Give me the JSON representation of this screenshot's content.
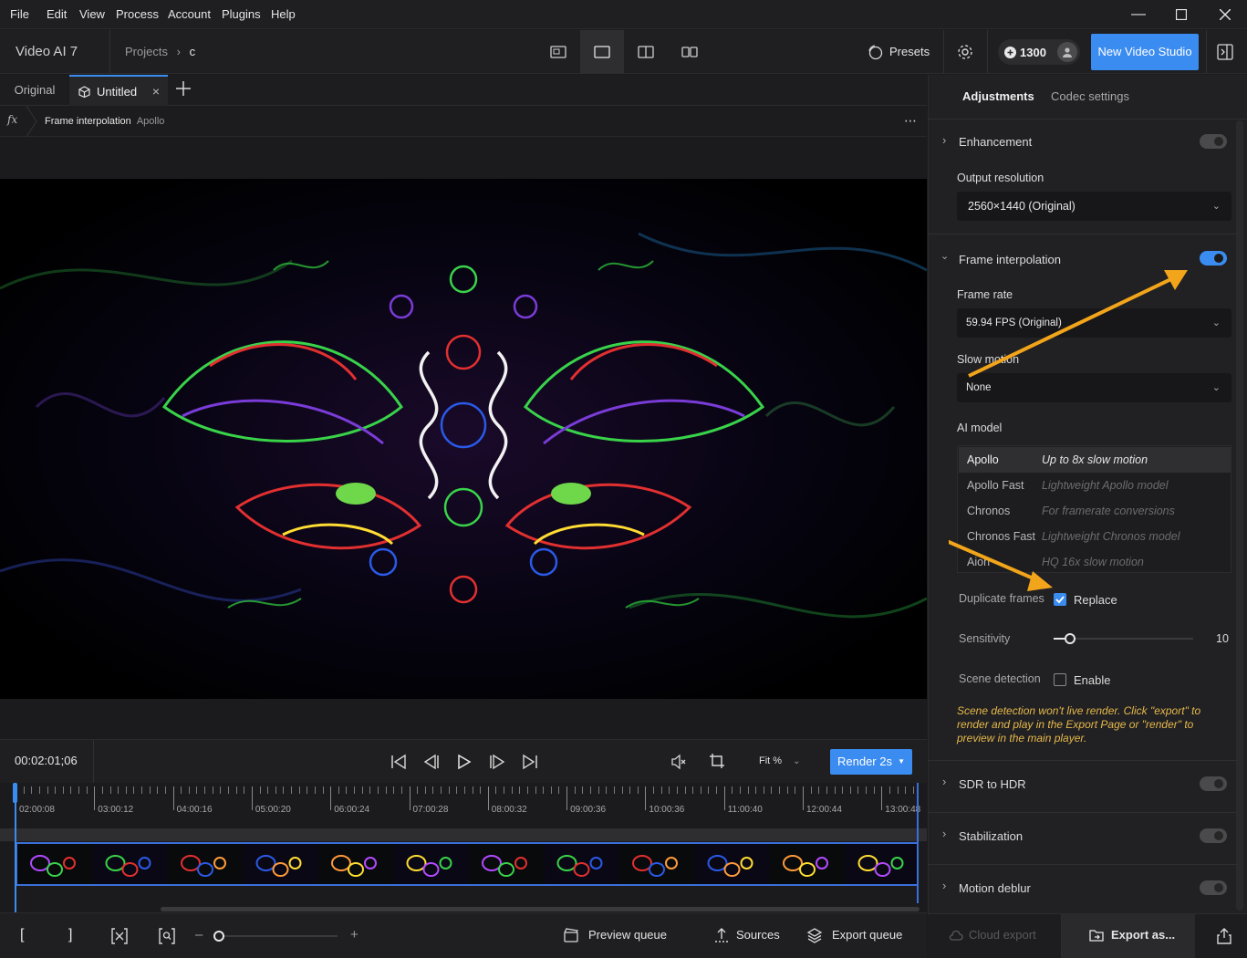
{
  "menu": [
    "File",
    "Edit",
    "View",
    "Process",
    "Account",
    "Plugins",
    "Help"
  ],
  "app": {
    "name": "Video AI",
    "version": "7"
  },
  "breadcrumb": {
    "projects": "Projects",
    "current": "c"
  },
  "header": {
    "presets": "Presets",
    "credits": "1300",
    "new_studio": "New Video Studio"
  },
  "tabs": {
    "original": "Original",
    "untitled": "Untitled"
  },
  "filter_crumb": {
    "name": "Frame interpolation",
    "model": "Apollo"
  },
  "player": {
    "timecode": "00:02:01;06",
    "fit": "Fit %",
    "render": "Render 2s"
  },
  "timeline_labels": [
    "02:00:08",
    "03:00:12",
    "04:00:16",
    "05:00:20",
    "06:00:24",
    "07:00:28",
    "08:00:32",
    "09:00:36",
    "10:00:36",
    "11:00:40",
    "12:00:44",
    "13:00:48"
  ],
  "bottom": {
    "in": "[",
    "out": "]",
    "preview_queue": "Preview queue",
    "sources": "Sources",
    "export_queue": "Export queue",
    "cloud_export": "Cloud export",
    "export_as": "Export as..."
  },
  "panel": {
    "tabs": [
      "Adjustments",
      "Codec settings"
    ],
    "enhancement": "Enhancement",
    "output_resolution_label": "Output resolution",
    "output_resolution": "2560×1440 (Original)",
    "frame_interpolation": "Frame interpolation",
    "frame_rate_label": "Frame rate",
    "frame_rate": "59.94 FPS (Original)",
    "slow_motion_label": "Slow motion",
    "slow_motion": "None",
    "ai_model_label": "AI model",
    "models": [
      {
        "name": "Apollo",
        "desc": "Up to 8x slow motion"
      },
      {
        "name": "Apollo Fast",
        "desc": "Lightweight Apollo model"
      },
      {
        "name": "Chronos",
        "desc": "For framerate conversions"
      },
      {
        "name": "Chronos Fast",
        "desc": "Lightweight Chronos model"
      },
      {
        "name": "Aion",
        "desc": "HQ 16x slow motion"
      }
    ],
    "duplicate_frames_label": "Duplicate frames",
    "replace": "Replace",
    "sensitivity_label": "Sensitivity",
    "sensitivity_value": "10",
    "sensitivity_fraction": 0.12,
    "scene_detection_label": "Scene detection",
    "enable": "Enable",
    "warning": "Scene detection won't live render. Click \"export\" to render and play in the Export Page or \"render\" to preview in the main player.",
    "sdr_to_hdr": "SDR to HDR",
    "stabilization": "Stabilization",
    "motion_deblur": "Motion deblur"
  },
  "colors": {
    "accent": "#3b8cf0",
    "warning": "#e6b84a",
    "arrow": "#f2a51a"
  }
}
